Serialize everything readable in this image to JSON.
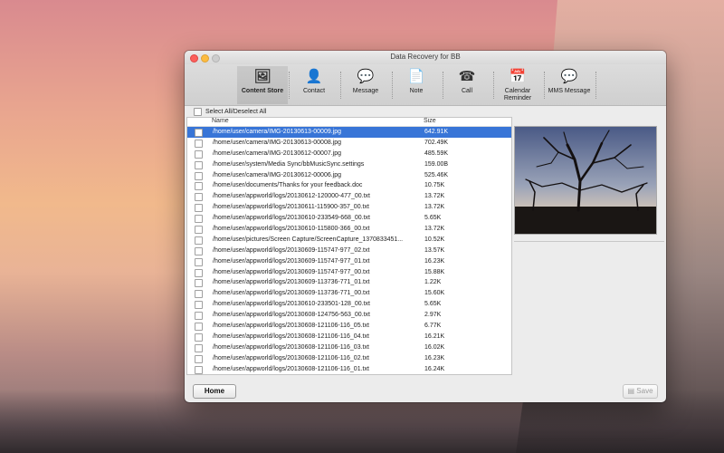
{
  "window": {
    "title": "Data Recovery for BB"
  },
  "toolbar": {
    "buttons": [
      {
        "label": "Content Store",
        "icon": "photos-icon",
        "glyph": "🖼",
        "active": true
      },
      {
        "label": "Contact",
        "icon": "contact-card-icon",
        "glyph": "👤"
      },
      {
        "label": "Message",
        "icon": "message-bubble-icon",
        "glyph": "💬"
      },
      {
        "label": "Note",
        "icon": "note-icon",
        "glyph": "📄"
      },
      {
        "label": "Call",
        "icon": "phone-icon",
        "glyph": "☎"
      },
      {
        "label": "Calendar Reminder",
        "icon": "calendar-icon",
        "glyph": "📅"
      },
      {
        "label": "MMS Message",
        "icon": "mms-icon",
        "glyph": "💬"
      }
    ]
  },
  "select_all": {
    "label": "Select All/Deselect All"
  },
  "file_list": {
    "columns": {
      "name": "Name",
      "size": "Size"
    },
    "rows": [
      {
        "name": "/home/user/camera/IMG-20130613-00009.jpg",
        "size": "642.91K",
        "selected": true
      },
      {
        "name": "/home/user/camera/IMG-20130613-00008.jpg",
        "size": "702.49K"
      },
      {
        "name": "/home/user/camera/IMG-20130612-00007.jpg",
        "size": "485.59K"
      },
      {
        "name": "/home/user/system/Media Sync/bbMusicSync.settings",
        "size": "159.00B"
      },
      {
        "name": "/home/user/camera/IMG-20130612-00006.jpg",
        "size": "525.46K"
      },
      {
        "name": "/home/user/documents/Thanks for your feedback.doc",
        "size": "10.75K"
      },
      {
        "name": "/home/user/appworld/logs/20130612-120000-477_00.txt",
        "size": "13.72K"
      },
      {
        "name": "/home/user/appworld/logs/20130611-115900-357_00.txt",
        "size": "13.72K"
      },
      {
        "name": "/home/user/appworld/logs/20130610-233549-668_00.txt",
        "size": "5.65K"
      },
      {
        "name": "/home/user/appworld/logs/20130610-115800-366_00.txt",
        "size": "13.72K"
      },
      {
        "name": "/home/user/pictures/Screen Capture/ScreenCapture_1370833451...",
        "size": "10.52K"
      },
      {
        "name": "/home/user/appworld/logs/20130609-115747-977_02.txt",
        "size": "13.57K"
      },
      {
        "name": "/home/user/appworld/logs/20130609-115747-977_01.txt",
        "size": "16.23K"
      },
      {
        "name": "/home/user/appworld/logs/20130609-115747-977_00.txt",
        "size": "15.88K"
      },
      {
        "name": "/home/user/appworld/logs/20130609-113736-771_01.txt",
        "size": "1.22K"
      },
      {
        "name": "/home/user/appworld/logs/20130609-113736-771_00.txt",
        "size": "15.60K"
      },
      {
        "name": "/home/user/appworld/logs/20130610-233501-128_00.txt",
        "size": "5.65K"
      },
      {
        "name": "/home/user/appworld/logs/20130608-124756-563_00.txt",
        "size": "2.97K"
      },
      {
        "name": "/home/user/appworld/logs/20130608-121106-116_05.txt",
        "size": "6.77K"
      },
      {
        "name": "/home/user/appworld/logs/20130608-121106-116_04.txt",
        "size": "16.21K"
      },
      {
        "name": "/home/user/appworld/logs/20130608-121106-116_03.txt",
        "size": "16.02K"
      },
      {
        "name": "/home/user/appworld/logs/20130608-121106-116_02.txt",
        "size": "16.23K"
      },
      {
        "name": "/home/user/appworld/logs/20130608-121106-116_01.txt",
        "size": "16.24K"
      }
    ]
  },
  "bottom": {
    "home_label": "Home",
    "save_label": "Save",
    "save_icon": "save-disk-icon"
  },
  "colors": {
    "selection": "#3875d7",
    "close": "#fc605c",
    "minimize": "#fdbc40"
  }
}
